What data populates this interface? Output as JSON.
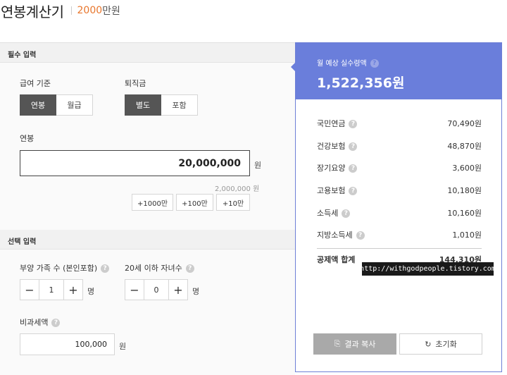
{
  "header": {
    "title": "연봉계산기",
    "amount": "2000",
    "amount_unit": "만원"
  },
  "required": {
    "section_title": "필수 입력",
    "pay_basis": {
      "label": "급여 기준",
      "options": [
        "연봉",
        "월급"
      ],
      "selected": "연봉"
    },
    "severance": {
      "label": "퇴직금",
      "options": [
        "별도",
        "포함"
      ],
      "selected": "별도"
    },
    "salary": {
      "label": "연봉",
      "value": "20,000,000",
      "unit": "원",
      "hint": "2,000,000",
      "hint_unit": "원"
    },
    "quick_add": [
      "+1000만",
      "+100만",
      "+10만"
    ]
  },
  "optional": {
    "section_title": "선택 입력",
    "dependents": {
      "label": "부양 가족 수 (본인포함)",
      "value": "1",
      "unit": "명"
    },
    "children": {
      "label": "20세 이하 자녀수",
      "value": "0",
      "unit": "명"
    },
    "nontaxable": {
      "label": "비과세액",
      "value": "100,000",
      "unit": "원"
    }
  },
  "result": {
    "label": "월 예상 실수령액",
    "value": "1,522,356원",
    "deductions": [
      {
        "name": "국민연금",
        "amount": "70,490원"
      },
      {
        "name": "건강보험",
        "amount": "48,870원"
      },
      {
        "name": "장기요양",
        "amount": "3,600원"
      },
      {
        "name": "고용보험",
        "amount": "10,180원"
      },
      {
        "name": "소득세",
        "amount": "10,160원"
      },
      {
        "name": "지방소득세",
        "amount": "1,010원"
      }
    ],
    "total": {
      "name": "공제액 합계",
      "amount": "144,310원"
    },
    "copy_label": "결과 복사",
    "reset_label": "초기화"
  },
  "watermark": "http://withgodpeople.tistory.com",
  "icons": {
    "help": "?",
    "minus": "−",
    "plus": "+",
    "copy": "⎘",
    "reset": "↻"
  },
  "colors": {
    "accent": "#6a7edb",
    "amount_orange": "#e8762c",
    "active_toggle": "#555555"
  }
}
